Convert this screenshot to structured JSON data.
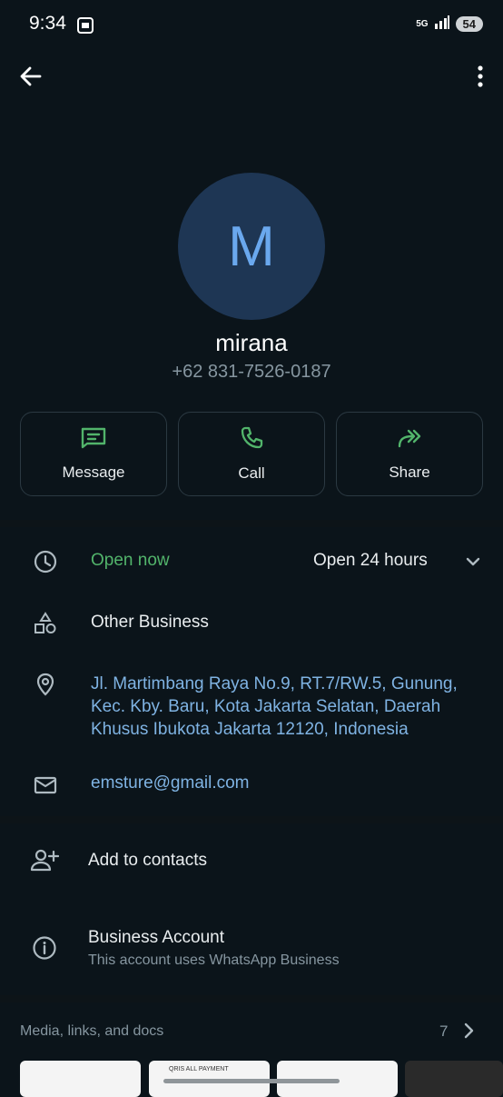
{
  "status": {
    "time": "9:34",
    "network": "5G",
    "battery": "54"
  },
  "contact": {
    "initial": "M",
    "name": "mirana",
    "phone": "+62 831-7526-0187"
  },
  "actions": [
    {
      "label": "Message",
      "icon": "message-icon"
    },
    {
      "label": "Call",
      "icon": "phone-icon"
    },
    {
      "label": "Share",
      "icon": "share-icon"
    }
  ],
  "business": {
    "hours_status": "Open now",
    "hours": "Open 24 hours",
    "category": "Other Business",
    "address_lines": [
      "Jl. Martimbang Raya No.9, RT.7/RW.5, Gunung,",
      "Kec. Kby. Baru, Kota Jakarta Selatan, Daerah",
      "Khusus Ibukota Jakarta 12120, Indonesia"
    ],
    "email": "emsture@gmail.com"
  },
  "add_contact": "Add to contacts",
  "account": {
    "title": "Business Account",
    "subtitle": "This account uses WhatsApp Business"
  },
  "media": {
    "label": "Media, links, and docs",
    "count": "7"
  },
  "thumb_snippets": [
    "",
    "QRIS ALL PAYMENT",
    "",
    ""
  ],
  "colors": {
    "accent_green": "#52b46b",
    "link_blue": "#7fb3e3",
    "background": "#0b141a"
  }
}
